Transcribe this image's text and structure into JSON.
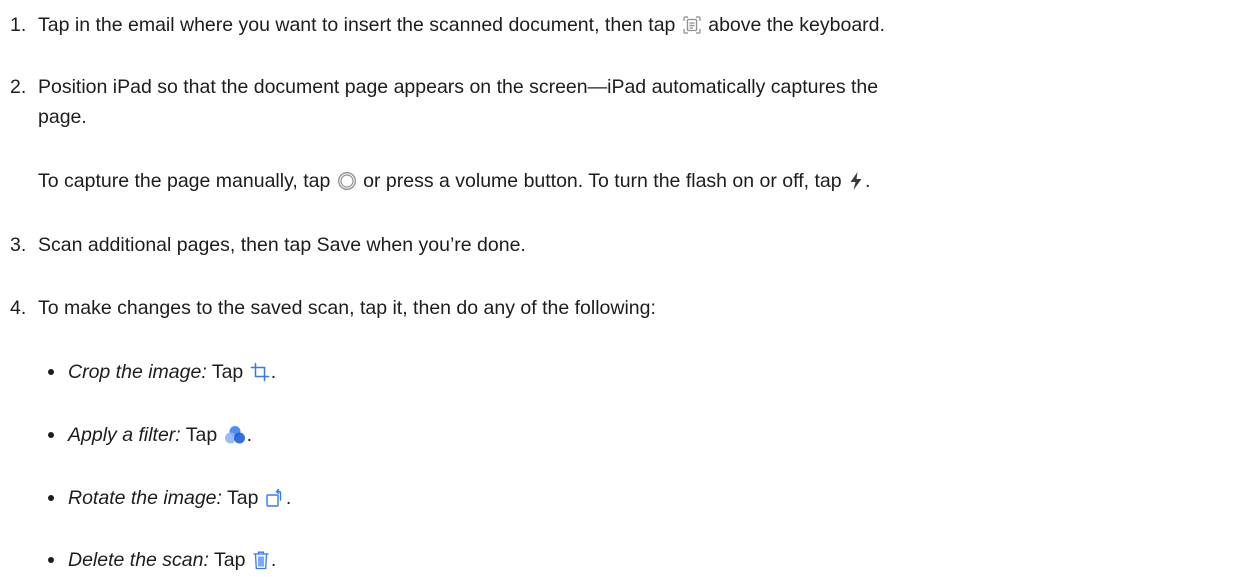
{
  "steps": [
    {
      "number": "1.",
      "before_icon": "Tap in the email where you want to insert the scanned document, then tap ",
      "icon": "scan-document-icon",
      "after_icon": " above the keyboard."
    },
    {
      "number": "2.",
      "line1": "Position iPad so that the document page appears on the screen—iPad automatically captures the",
      "line2": "page.",
      "note_part1": "To capture the page manually, tap ",
      "note_icon1": "shutter-icon",
      "note_part2": " or press a volume button. To turn the flash on or off, tap ",
      "note_icon2": "flash-icon",
      "note_part3": "."
    },
    {
      "number": "3.",
      "text": "Scan additional pages, then tap Save when you’re done."
    },
    {
      "number": "4.",
      "text": "To make changes to the saved scan, tap it, then do any of the following:",
      "bullets": [
        {
          "label": "Crop the image:",
          "text": " Tap ",
          "icon": "crop-icon",
          "end": "."
        },
        {
          "label": "Apply a filter:",
          "text": " Tap ",
          "icon": "filter-icon",
          "end": "."
        },
        {
          "label": "Rotate the image:",
          "text": " Tap ",
          "icon": "rotate-icon",
          "end": "."
        },
        {
          "label": "Delete the scan:",
          "text": " Tap ",
          "icon": "trash-icon",
          "end": "."
        }
      ]
    }
  ],
  "colors": {
    "text": "#1d1d1f",
    "accent": "#3478f6",
    "icon_gray": "#8e8e93"
  }
}
